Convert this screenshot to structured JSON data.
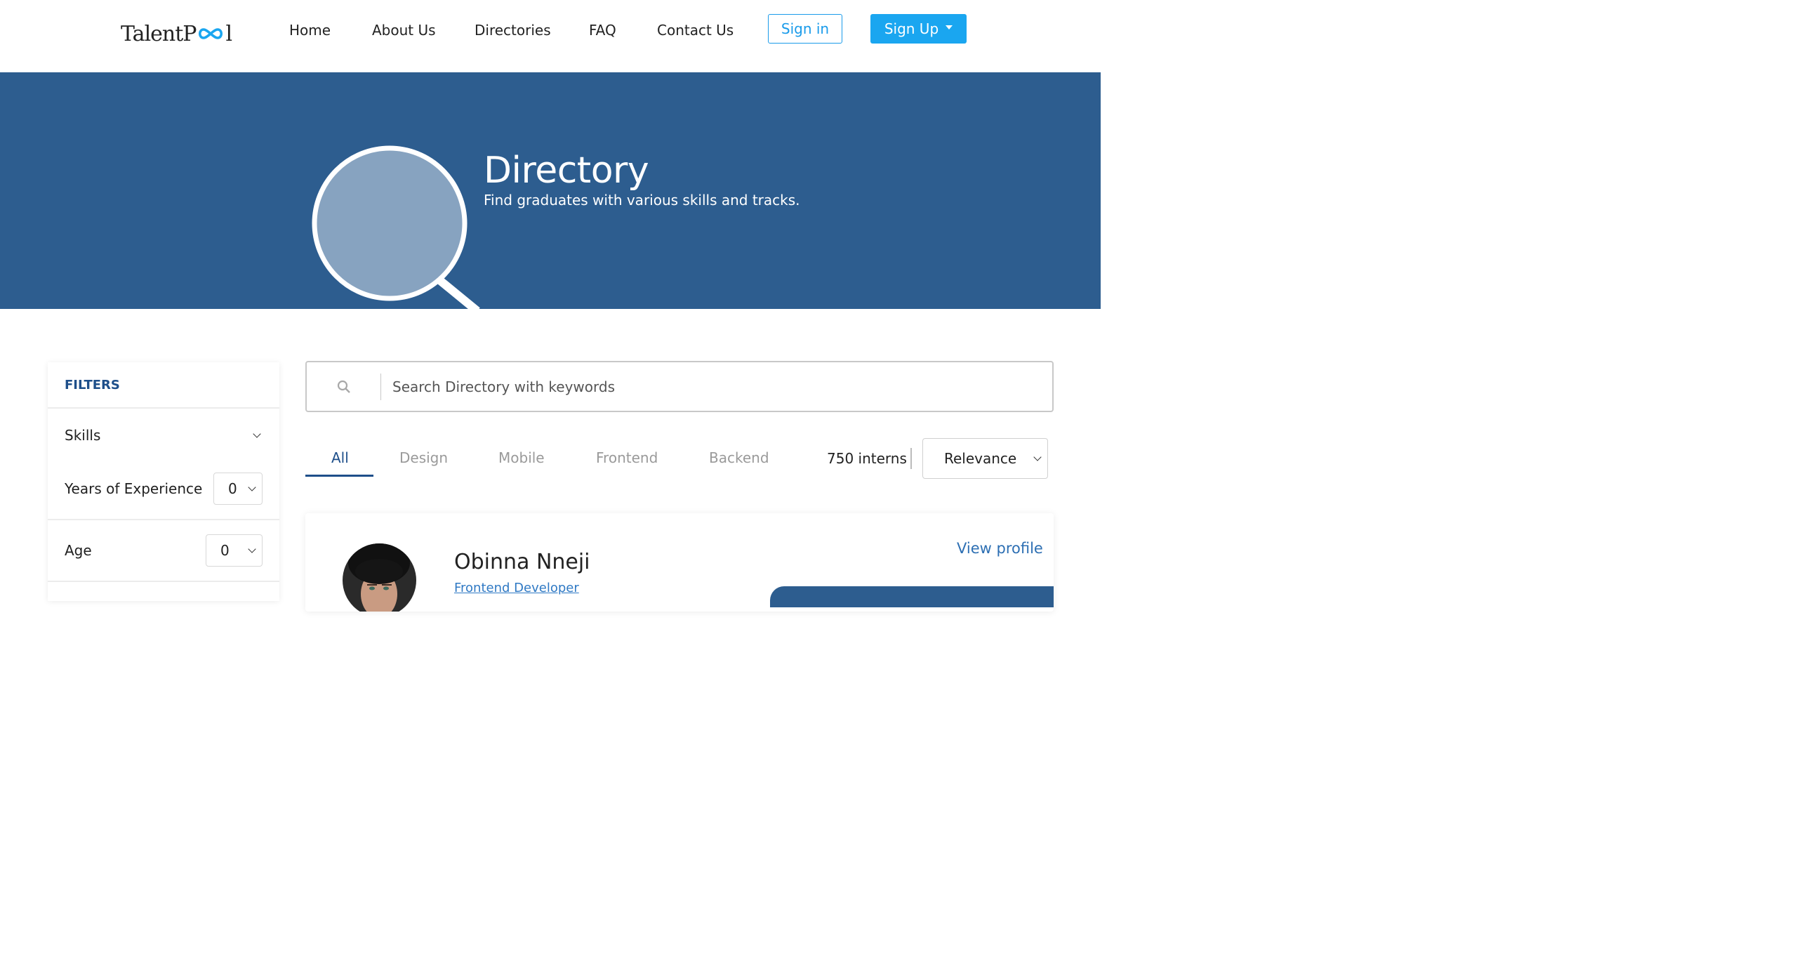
{
  "brand": {
    "logo_text_left": "TalentP",
    "logo_text_right": "l",
    "accent": "#1aa6f0",
    "primary": "#2d5d8f"
  },
  "nav": {
    "links": [
      "Home",
      "About Us",
      "Directories",
      "FAQ",
      "Contact Us"
    ],
    "sign_in": "Sign in",
    "sign_up": "Sign Up"
  },
  "hero": {
    "title": "Directory",
    "subtitle": "Find graduates with various skills and tracks."
  },
  "filters": {
    "heading": "FILTERS",
    "skills_label": "Skills",
    "experience_label": "Years of Experience",
    "experience_value": "0",
    "age_label": "Age",
    "age_value": "0"
  },
  "search": {
    "placeholder": "Search Directory with keywords"
  },
  "tabs": [
    "All",
    "Design",
    "Mobile",
    "Frontend",
    "Backend"
  ],
  "active_tab": "All",
  "results": {
    "count_text": "750 interns",
    "sort_value": "Relevance"
  },
  "card": {
    "name": "Obinna Nneji",
    "role": "Frontend Developer",
    "view_profile": "View profile"
  }
}
